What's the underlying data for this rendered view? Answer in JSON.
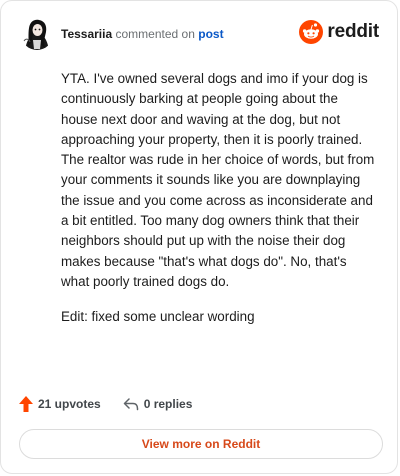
{
  "header": {
    "username": "Tessariia",
    "action_text": "commented on",
    "post_link": "post",
    "brand": "reddit"
  },
  "comment": {
    "body": "YTA. I've owned several dogs and imo if your dog is continuously barking at people going about the house next door and waving at the dog, but not approaching your property, then it is poorly trained. The realtor was rude in her choice of words, but from your comments it sounds like you are downplaying the issue and you come across as inconsiderate and a bit entitled. Too many dog owners think that their neighbors should put up with the noise their dog makes because \"that's what dogs do\". No, that's what poorly trained dogs do.",
    "edit": "Edit: fixed some unclear wording"
  },
  "actions": {
    "upvotes": "21 upvotes",
    "replies": "0 replies"
  },
  "view_more": "View more on Reddit",
  "colors": {
    "brand": "#ff4500",
    "link": "#0a58c7",
    "view_more_text": "#d7491a"
  },
  "icons": [
    "avatar",
    "reddit-logo-icon",
    "upvote-arrow-icon",
    "reply-arrow-icon"
  ]
}
